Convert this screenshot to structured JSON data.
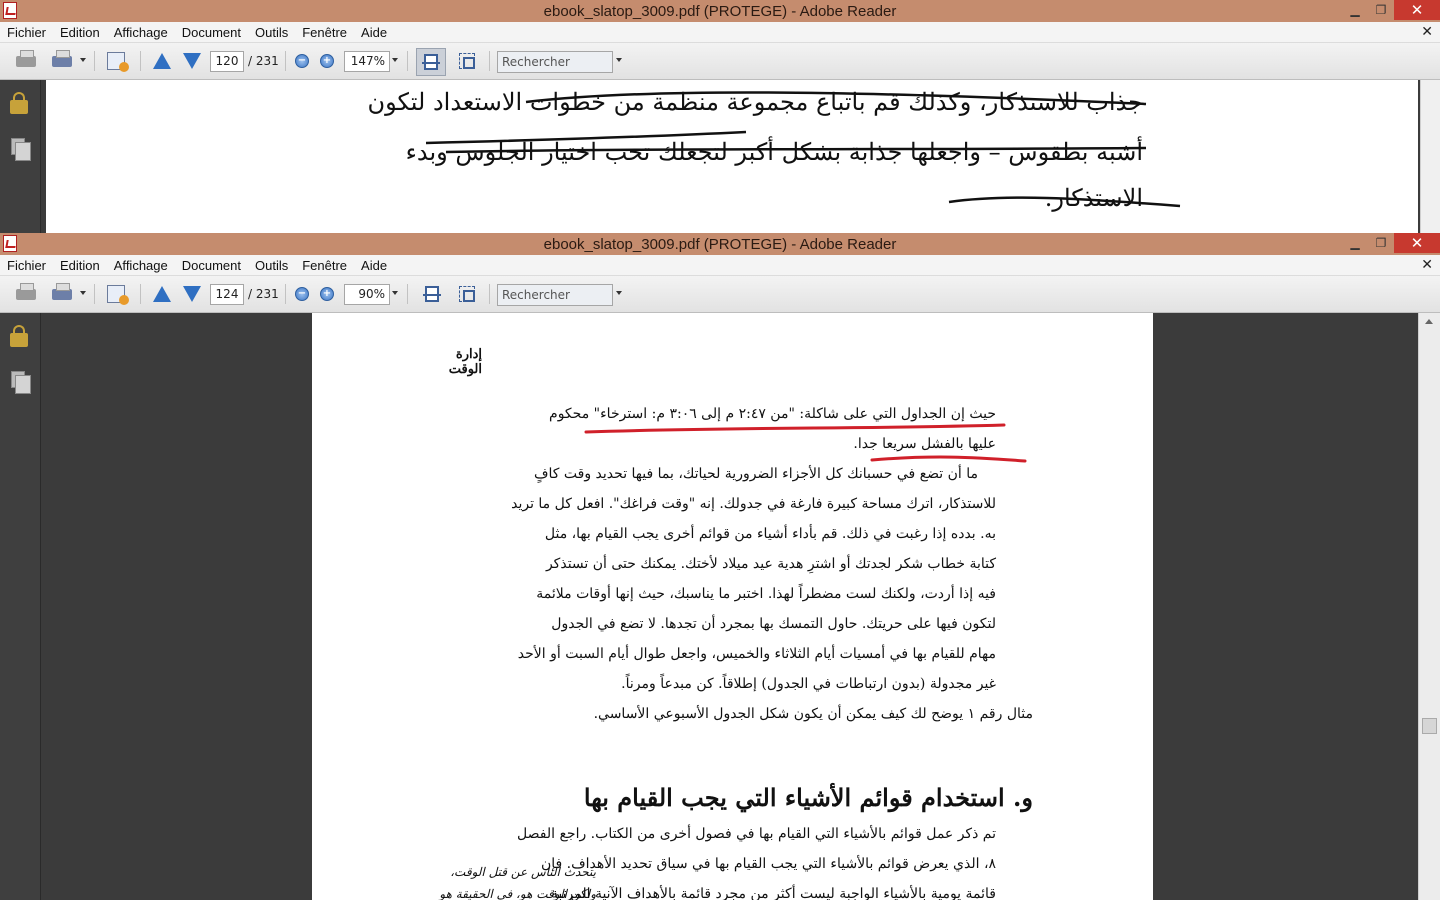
{
  "window_back": {
    "title": "ebook_slatop_3009.pdf (PROTEGE) - Adobe Reader",
    "menu": [
      "Fichier",
      "Edition",
      "Affichage",
      "Document",
      "Outils",
      "Fenêtre",
      "Aide"
    ],
    "page_current": "120",
    "page_total": "/ 231",
    "zoom": "147%",
    "search_placeholder": "Rechercher",
    "lines": [
      "جذاب للاستذكار، وكذلك قم باتباع مجموعة منظمة من خطوات الاستعداد  لتكون",
      "أشبه بطقوس – واجعلها جذابة بشكل أكبر لتجعلك تحب اختيار الجلوس وبدء",
      "الاستذكار."
    ]
  },
  "window_front": {
    "title": "ebook_slatop_3009.pdf (PROTEGE) - Adobe Reader",
    "menu": [
      "Fichier",
      "Edition",
      "Affichage",
      "Document",
      "Outils",
      "Fenêtre",
      "Aide"
    ],
    "page_current": "124",
    "page_total": "/ 231",
    "zoom": "90%",
    "search_placeholder": "Rechercher",
    "running_head": "إدارة الوقت",
    "paragraph_lines": [
      "حيث إن الجداول التي على شاكلة: \"من ٢:٤٧ م إلى ٣:٠٦ م: استرخاء\" محكوم",
      "عليها بالفشل سريعا جدا.",
      "ما أن تضع في حسبانك كل الأجزاء الضرورية لحياتك، بما فيها تحديد وقت كافٍ",
      "للاستذكار، اترك مساحة كبيرة فارغة في جدولك. إنه \"وقت فراغك\". افعل كل ما تريد",
      "به. بدده إذا رغبت في ذلك. قم بأداء أشياء من قوائم أخرى يجب القيام بها، مثل",
      "كتابة خطاب شكر لجدتك أو اشترِ هدية عيد ميلاد لأختك. يمكنك حتى أن تستذكر",
      "فيه إذا أردت، ولكنك لست مضطراً لهذا. اختبر ما يناسبك، حيث إنها أوقات ملائمة",
      "لتكون فيها على حريتك. حاول التمسك بها بمجرد أن تجدها. لا تضع في الجدول",
      "مهام للقيام بها في أمسيات أيام الثلاثاء والخميس، واجعل طوال أيام السبت أو الأحد",
      "غير مجدولة (بدون ارتباطات في الجدول) إطلاقاً. كن مبدعاً ومرناً.",
      "مثال رقم ١ يوضح لك كيف يمكن أن يكون شكل الجدول الأسبوعي الأساسي."
    ],
    "section_heading": "و. استخدام قوائم الأشياء التي يجب القيام بها",
    "section_lines": [
      "تم ذكر عمل قوائم بالأشياء التي القيام بها في فصول أخرى من الكتاب. راجع الفصل",
      "٨، الذي يعرض قوائم بالأشياء التي يجب القيام بها في سياق تحديد الأهداف. فإن",
      "قائمة يومية بالأشياء الواجبة ليست أكثر من مجرد قائمة بالأهداف الآنية المرتبة"
    ],
    "sidenote_lines": [
      "يتحدث الناس عن قتل الوقت،",
      "ولكن الوقت هو، في الحقيقة هو"
    ]
  },
  "colors": {
    "titlebar": "#c58c6e",
    "close": "#c7392f",
    "annotation_red": "#d0202a",
    "annotation_ink": "#111111"
  }
}
